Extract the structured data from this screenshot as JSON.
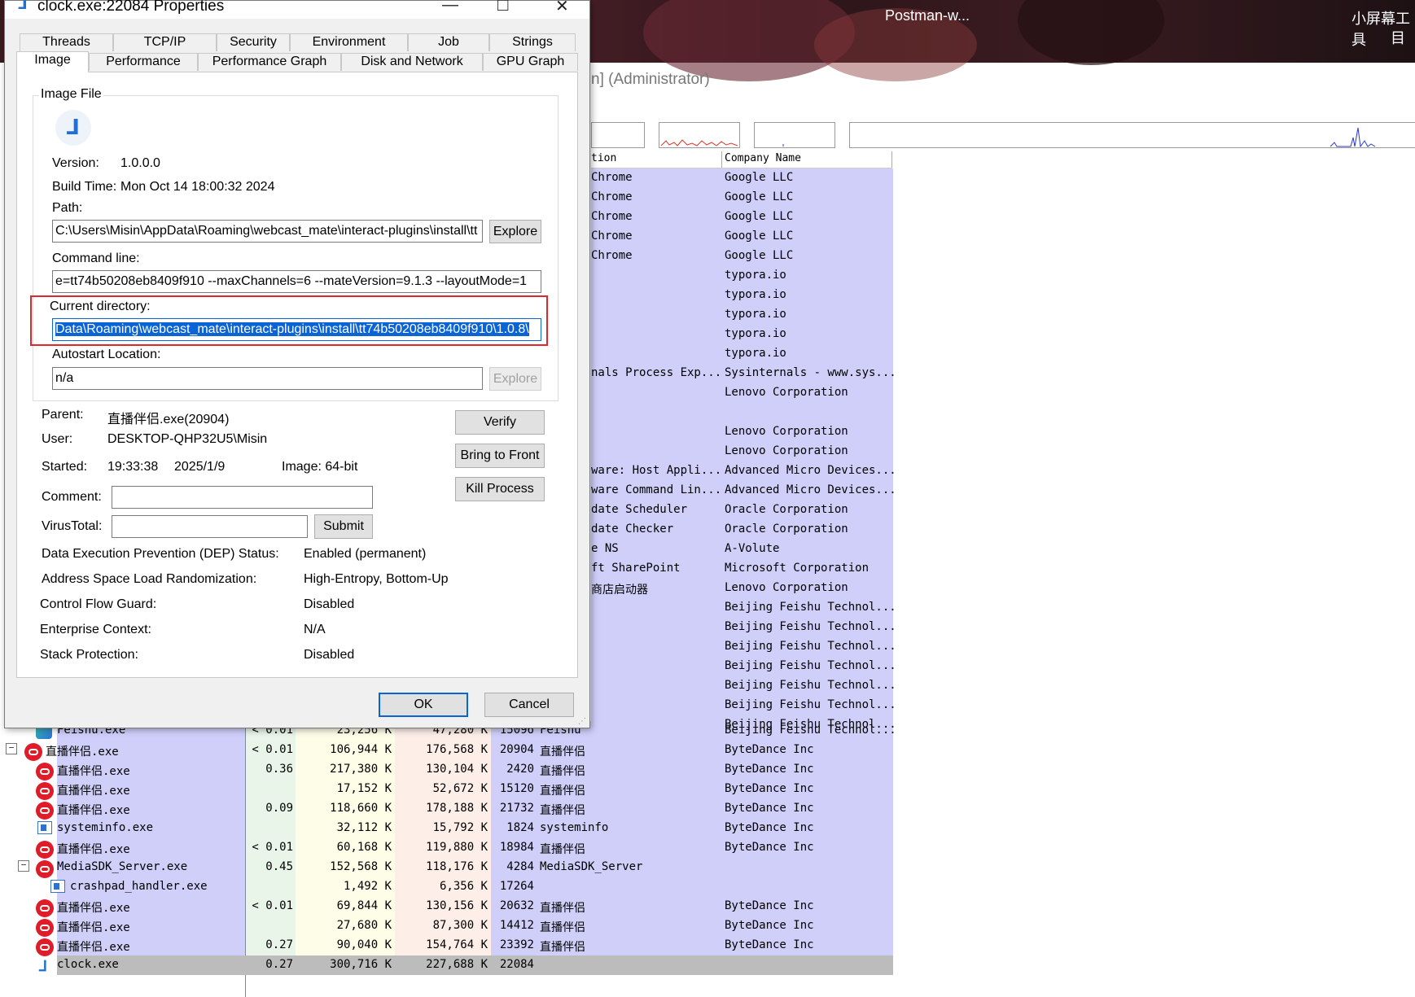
{
  "taskbar": {
    "left_item": "Postman-w...",
    "right_item_line1": "小屏幕工具",
    "right_item_line2": "目"
  },
  "bg_window": {
    "title_fragment": "n] (Administrator)"
  },
  "process_columns": {
    "description": "tion",
    "company": "Company Name"
  },
  "upper_rows": [
    {
      "desc": "Chrome",
      "company": "Google LLC"
    },
    {
      "desc": "Chrome",
      "company": "Google LLC"
    },
    {
      "desc": "Chrome",
      "company": "Google LLC"
    },
    {
      "desc": "Chrome",
      "company": "Google LLC"
    },
    {
      "desc": "Chrome",
      "company": "Google LLC"
    },
    {
      "desc": "",
      "company": "typora.io"
    },
    {
      "desc": "",
      "company": "typora.io"
    },
    {
      "desc": "",
      "company": "typora.io"
    },
    {
      "desc": "",
      "company": "typora.io"
    },
    {
      "desc": "",
      "company": "typora.io"
    },
    {
      "desc": "nals Process Exp...",
      "company": "Sysinternals - www.sys..."
    },
    {
      "desc": "",
      "company": "Lenovo Corporation"
    },
    {
      "desc": "",
      "company": ""
    },
    {
      "desc": "",
      "company": "Lenovo Corporation"
    },
    {
      "desc": "",
      "company": "Lenovo Corporation"
    },
    {
      "desc": "ware: Host Appli...",
      "company": "Advanced Micro Devices..."
    },
    {
      "desc": "ware Command Lin...",
      "company": "Advanced Micro Devices..."
    },
    {
      "desc": "date Scheduler",
      "company": "Oracle Corporation"
    },
    {
      "desc": "date Checker",
      "company": "Oracle Corporation"
    },
    {
      "desc": "e NS",
      "company": "A-Volute"
    },
    {
      "desc": "ft SharePoint",
      "company": "Microsoft Corporation"
    },
    {
      "desc": "商店启动器",
      "company": "Lenovo Corporation"
    },
    {
      "desc": "",
      "company": "Beijing Feishu Technol..."
    },
    {
      "desc": "",
      "company": "Beijing Feishu Technol..."
    },
    {
      "desc": "",
      "company": "Beijing Feishu Technol..."
    },
    {
      "desc": "",
      "company": "Beijing Feishu Technol..."
    },
    {
      "desc": "",
      "company": "Beijing Feishu Technol..."
    },
    {
      "desc": "",
      "company": "Beijing Feishu Technol..."
    },
    {
      "desc": "",
      "company": "Beijing Feishu Technol..."
    }
  ],
  "lower_rows": [
    {
      "name": "Feishu.exe",
      "cpu": "< 0.01",
      "priv": "23,256 K",
      "ws": "47,280 K",
      "pid": "15096",
      "desc": "Feishu",
      "company": "Beijing Feishu Technol...",
      "icon": "feishu-icon"
    },
    {
      "name": "直播伴侣.exe",
      "cpu": "< 0.01",
      "priv": "106,944 K",
      "ws": "176,568 K",
      "pid": "20904",
      "desc": "直播伴侣",
      "company": "ByteDance Inc",
      "icon": "bytedance-icon"
    },
    {
      "name": "直播伴侣.exe",
      "cpu": "0.36",
      "priv": "217,380 K",
      "ws": "130,104 K",
      "pid": "2420",
      "desc": "直播伴侣",
      "company": "ByteDance Inc",
      "icon": "bytedance-icon"
    },
    {
      "name": "直播伴侣.exe",
      "cpu": "",
      "priv": "17,152 K",
      "ws": "52,672 K",
      "pid": "15120",
      "desc": "直播伴侣",
      "company": "ByteDance Inc",
      "icon": "bytedance-icon"
    },
    {
      "name": "直播伴侣.exe",
      "cpu": "0.09",
      "priv": "118,660 K",
      "ws": "178,188 K",
      "pid": "21732",
      "desc": "直播伴侣",
      "company": "ByteDance Inc",
      "icon": "bytedance-icon"
    },
    {
      "name": "systeminfo.exe",
      "cpu": "",
      "priv": "32,112 K",
      "ws": "15,792 K",
      "pid": "1824",
      "desc": "systeminfo",
      "company": "ByteDance Inc",
      "icon": "window-icon"
    },
    {
      "name": "直播伴侣.exe",
      "cpu": "< 0.01",
      "priv": "60,168 K",
      "ws": "119,880 K",
      "pid": "18984",
      "desc": "直播伴侣",
      "company": "ByteDance Inc",
      "icon": "bytedance-icon"
    },
    {
      "name": "MediaSDK_Server.exe",
      "cpu": "0.45",
      "priv": "152,568 K",
      "ws": "118,176 K",
      "pid": "4284",
      "desc": "MediaSDK_Server",
      "company": "",
      "icon": "bytedance-icon"
    },
    {
      "name": "crashpad_handler.exe",
      "cpu": "",
      "priv": "1,492 K",
      "ws": "6,356 K",
      "pid": "17264",
      "desc": "",
      "company": "",
      "icon": "window-icon"
    },
    {
      "name": "直播伴侣.exe",
      "cpu": "< 0.01",
      "priv": "69,844 K",
      "ws": "130,156 K",
      "pid": "20632",
      "desc": "直播伴侣",
      "company": "ByteDance Inc",
      "icon": "bytedance-icon"
    },
    {
      "name": "直播伴侣.exe",
      "cpu": "",
      "priv": "27,680 K",
      "ws": "87,300 K",
      "pid": "14412",
      "desc": "直播伴侣",
      "company": "ByteDance Inc",
      "icon": "bytedance-icon"
    },
    {
      "name": "直播伴侣.exe",
      "cpu": "0.27",
      "priv": "90,040 K",
      "ws": "154,764 K",
      "pid": "23392",
      "desc": "直播伴侣",
      "company": "ByteDance Inc",
      "icon": "bytedance-icon"
    },
    {
      "name": "clock.exe",
      "cpu": "0.27",
      "priv": "300,716 K",
      "ws": "227,688 K",
      "pid": "22084",
      "desc": "",
      "company": "",
      "icon": "clock-icon"
    }
  ],
  "dialog": {
    "title": "clock.exe:22084 Properties",
    "tabs_row1": [
      "Threads",
      "TCP/IP",
      "Security",
      "Environment",
      "Job",
      "Strings"
    ],
    "tabs_row2": [
      "Image",
      "Performance",
      "Performance Graph",
      "Disk and Network",
      "GPU Graph"
    ],
    "active_tab": "Image",
    "image_file_group": "Image File",
    "version_label": "Version:",
    "version_value": "1.0.0.0",
    "build_time_label": "Build Time:",
    "build_time_value": "Mon Oct 14 18:00:32 2024",
    "path_label": "Path:",
    "path_value": "C:\\Users\\Misin\\AppData\\Roaming\\webcast_mate\\interact-plugins\\install\\tt",
    "explore_label": "Explore",
    "cmdline_label": "Command line:",
    "cmdline_value": "e=tt74b50208eb8409f910 --maxChannels=6 --mateVersion=9.1.3 --layoutMode=1",
    "curdir_label": "Current directory:",
    "curdir_value": "Data\\Roaming\\webcast_mate\\interact-plugins\\install\\tt74b50208eb8409f910\\1.0.8\\",
    "autostart_label": "Autostart Location:",
    "autostart_value": "n/a",
    "autostart_explore_label": "Explore",
    "parent_label": "Parent:",
    "parent_value": "直播伴侣.exe(20904)",
    "user_label": "User:",
    "user_value": "DESKTOP-QHP32U5\\Misin",
    "started_label": "Started:",
    "started_time": "19:33:38",
    "started_date": "2025/1/9",
    "image_bits": "Image: 64-bit",
    "verify_label": "Verify",
    "bring_front_label": "Bring to Front",
    "kill_label": "Kill Process",
    "comment_label": "Comment:",
    "comment_value": "",
    "virustotal_label": "VirusTotal:",
    "virustotal_value": "",
    "submit_label": "Submit",
    "dep_label": "Data Execution Prevention (DEP) Status:",
    "dep_value": "Enabled (permanent)",
    "aslr_label": "Address Space Load Randomization:",
    "aslr_value": "High-Entropy, Bottom-Up",
    "cfg_label": "Control Flow Guard:",
    "cfg_value": "Disabled",
    "ent_label": "Enterprise Context:",
    "ent_value": "N/A",
    "stack_label": "Stack Protection:",
    "stack_value": "Disabled",
    "ok_label": "OK",
    "cancel_label": "Cancel"
  },
  "colors": {
    "process_blue": "#cfcffa",
    "cpu_green": "#e8f5e8",
    "priv_yellow": "#fdfde8",
    "ws_pink": "#fdeee8",
    "selected_gray": "#bcbcbc",
    "selection": "#0a64d6",
    "highlight_red": "#e0282a"
  }
}
